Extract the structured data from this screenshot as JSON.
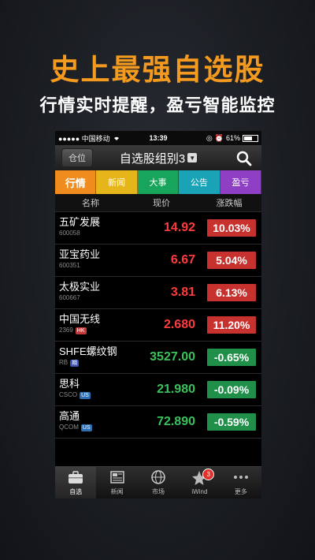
{
  "promo": {
    "title": "史上最强自选股",
    "subtitle": "行情实时提醒，盈亏智能监控"
  },
  "status_bar": {
    "carrier": "●●●●● 中国移动",
    "time": "13:39",
    "battery": "61%",
    "battery_level": 0.61
  },
  "nav": {
    "position_label": "仓位",
    "group_title": "自选股组别3",
    "caret_icon": "triangle-down-icon",
    "search_icon": "search-icon"
  },
  "tabs": [
    {
      "label": "行情",
      "color": "#f08c1d",
      "active": true
    },
    {
      "label": "新闻",
      "color": "#e5b519",
      "active": false
    },
    {
      "label": "大事",
      "color": "#16a55a",
      "active": false
    },
    {
      "label": "公告",
      "color": "#1aa3b6",
      "active": false
    },
    {
      "label": "盈亏",
      "color": "#8f3fc4",
      "active": false
    }
  ],
  "columns": {
    "name": "名称",
    "price": "现价",
    "change": "涨跌幅"
  },
  "colors": {
    "up_text": "#ff3b3b",
    "up_bg": "#c7322e",
    "down_text": "#39c25a",
    "down_bg": "#1f8f49"
  },
  "stocks": [
    {
      "name": "五矿发展",
      "code": "600058",
      "badge": "",
      "price": "14.92",
      "change": "10.03%",
      "direction": "up"
    },
    {
      "name": "亚宝药业",
      "code": "600351",
      "badge": "",
      "price": "6.67",
      "change": "5.04%",
      "direction": "up"
    },
    {
      "name": "太极实业",
      "code": "600667",
      "badge": "",
      "price": "3.81",
      "change": "6.13%",
      "direction": "up"
    },
    {
      "name": "中国无线",
      "code": "2369",
      "badge": "HK",
      "badge_color": "#c43a3a",
      "price": "2.680",
      "change": "11.20%",
      "direction": "up"
    },
    {
      "name": "SHFE螺纹钢",
      "code": "RB",
      "badge": "期",
      "badge_color": "#3a4fb0",
      "price": "3527.00",
      "change": "-0.65%",
      "direction": "down"
    },
    {
      "name": "思科",
      "code": "CSCO",
      "badge": "US",
      "badge_color": "#2d6fb5",
      "price": "21.980",
      "change": "-0.09%",
      "direction": "down"
    },
    {
      "name": "高通",
      "code": "QCOM",
      "badge": "US",
      "badge_color": "#2d6fb5",
      "price": "72.890",
      "change": "-0.59%",
      "direction": "down"
    }
  ],
  "tab_bar": [
    {
      "label": "自选",
      "icon": "briefcase-icon",
      "active": true
    },
    {
      "label": "新闻",
      "icon": "newspaper-icon",
      "active": false
    },
    {
      "label": "市场",
      "icon": "globe-icon",
      "active": false
    },
    {
      "label": "iWind",
      "icon": "star-icon",
      "active": false,
      "badge": "3"
    },
    {
      "label": "更多",
      "icon": "more-icon",
      "active": false
    }
  ]
}
